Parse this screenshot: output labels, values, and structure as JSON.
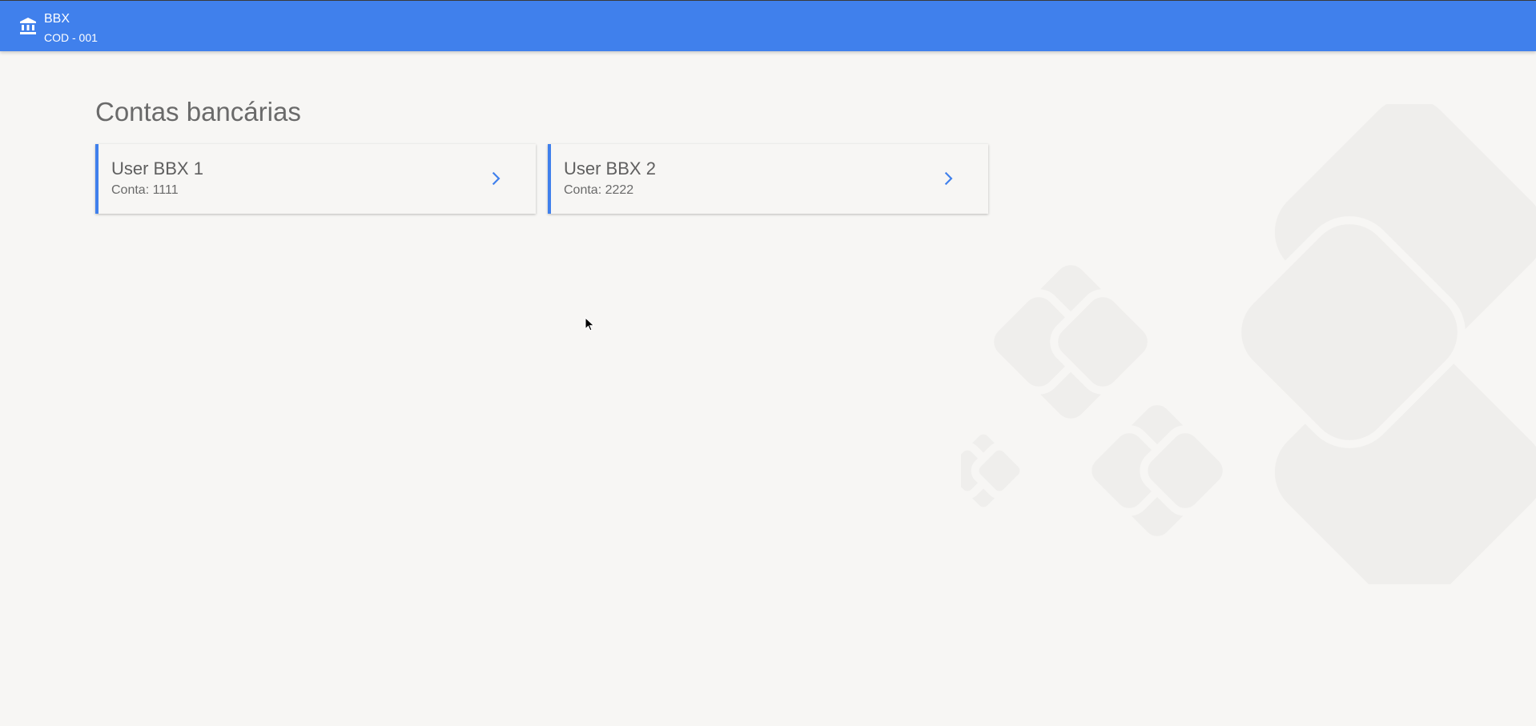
{
  "header": {
    "brand_name": "BBX",
    "brand_code": "COD - 001",
    "icon": "bank-icon",
    "color": "#4080ec"
  },
  "main": {
    "title": "Contas bancárias",
    "accounts": [
      {
        "name": "User BBX 1",
        "account": "Conta: 1111",
        "icon": "chevron-right-icon"
      },
      {
        "name": "User BBX 2",
        "account": "Conta: 2222",
        "icon": "chevron-right-icon"
      }
    ]
  },
  "colors": {
    "accent": "#4080ec",
    "background": "#f7f6f4",
    "text": "#5f5f5f"
  }
}
